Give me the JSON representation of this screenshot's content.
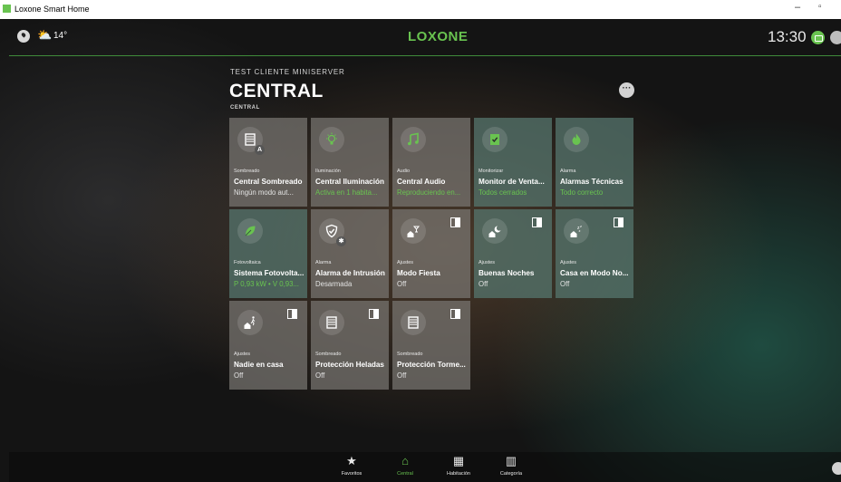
{
  "window": {
    "title": "Loxone Smart Home",
    "minimize": "–",
    "maximize": "▫"
  },
  "topbar": {
    "temperature": "14°",
    "brand": "LOXONE",
    "time": "13:30",
    "weather_icon": "partly-sunny-icon"
  },
  "header": {
    "subtitle": "TEST CLIENTE MINISERVER",
    "title": "CENTRAL",
    "section": "CENTRAL",
    "more": "···"
  },
  "colors": {
    "accent": "#69c350",
    "tile": "#7a7672",
    "tile_cool": "#567a6e"
  },
  "tiles": [
    {
      "category": "Sombreado",
      "name": "Central Sombreado",
      "status": "Ningún modo aut...",
      "badge": "A",
      "icon": "blind-icon"
    },
    {
      "category": "Iluminación",
      "name": "Central Iluminación",
      "status": "Activa en 1 habita...",
      "icon": "bulb-icon"
    },
    {
      "category": "Audio",
      "name": "Central Audio",
      "status": "Reproduciendo en...",
      "icon": "music-note-icon"
    },
    {
      "category": "Monitorizar",
      "name": "Monitor de Venta...",
      "status": "Todos cerrados",
      "icon": "window-check-icon"
    },
    {
      "category": "Alarma",
      "name": "Alarmas Técnicas",
      "status": "Todo correcto",
      "icon": "flame-icon"
    },
    {
      "category": "Fotovoltaica",
      "name": "Sistema Fotovolta...",
      "status": "P 0,93 kW • V 0,93...",
      "icon": "leaf-icon"
    },
    {
      "category": "Alarma",
      "name": "Alarma de Intrusión",
      "status": "Desarmada",
      "icon": "shield-icon"
    },
    {
      "category": "Ajustes",
      "name": "Modo Fiesta",
      "status": "Off",
      "icon": "party-house-icon"
    },
    {
      "category": "Ajustes",
      "name": "Buenas Noches",
      "status": "Off",
      "icon": "moon-house-icon"
    },
    {
      "category": "Ajustes",
      "name": "Casa en Modo No...",
      "status": "Off",
      "icon": "sleep-house-icon"
    },
    {
      "category": "Ajustes",
      "name": "Nadie en casa",
      "status": "Off",
      "icon": "away-house-icon"
    },
    {
      "category": "Sombreado",
      "name": "Protección Heladas",
      "status": "Off",
      "icon": "blind-icon"
    },
    {
      "category": "Sombreado",
      "name": "Protección Torme...",
      "status": "Off",
      "icon": "blind-icon"
    }
  ],
  "nav": [
    {
      "label": "Favoritos",
      "icon": "★"
    },
    {
      "label": "Central",
      "icon": "⌂"
    },
    {
      "label": "Habitación",
      "icon": "▦"
    },
    {
      "label": "Categoría",
      "icon": "▥"
    }
  ]
}
